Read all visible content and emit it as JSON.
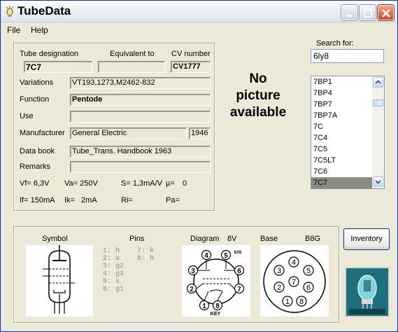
{
  "window": {
    "title": "TubeData"
  },
  "menu": {
    "file": "File",
    "help": "Help"
  },
  "tube": {
    "designation_label": "Tube designation",
    "designation": "7C7",
    "equivalent_label": "Equivalent to",
    "equivalent": "",
    "cv_label": "CV number",
    "cv": "CV1777",
    "variations_label": "Variations",
    "variations": "VT193,1273,M2462-832",
    "function_label": "Function",
    "function": "Pentode",
    "use_label": "Use",
    "use": "",
    "manufacturer_label": "Manufacturer",
    "manufacturer": "General Electric",
    "year": "1946",
    "databook_label": "Data book",
    "databook": "Tube_Trans. Handbook 1963",
    "remarks_label": "Remarks",
    "remarks": "",
    "vf": "Vf= 6,3V",
    "va": "Va= 250V",
    "s": "S= 1,3mA/V",
    "mu": "µ=",
    "mu_val": "0",
    "if": "If= 150mA",
    "ik": "Ik=",
    "ik_val": "2mA",
    "ri": "Ri=",
    "pa": "Pa="
  },
  "picture": {
    "line1": "No",
    "line2": "picture",
    "line3": "available"
  },
  "search": {
    "label": "Search for:",
    "value": "6ly8"
  },
  "list": {
    "items": [
      "7BP1",
      "7BP4",
      "7BP7",
      "7BP7A",
      "7C",
      "7C4",
      "7C5",
      "7C5LT",
      "7C6",
      "7C7"
    ],
    "selected": "7C7"
  },
  "bottom": {
    "symbol_label": "Symbol",
    "pins_label": "Pins",
    "diagram_label": "Diagram",
    "diagram_code": "8V",
    "base_label": "Base",
    "base_code": "B8G",
    "pins": [
      "1: h",
      "2: a",
      "3: g2",
      "4: g3",
      "5: s",
      "6: g1",
      "7: k",
      "8: h"
    ],
    "diagram_pin_labels": [
      "4",
      "5",
      "S/IS",
      "3",
      "6",
      "2",
      "7",
      "1",
      "8",
      "KEY"
    ],
    "base_pin_labels": [
      "3",
      "4",
      "5",
      "2",
      "6",
      "1",
      "8",
      "7"
    ]
  },
  "inventory_label": "Inventory",
  "colors": {
    "title_bar": "#eef0f6",
    "selection": "#8d8a80",
    "window_bg": "#ece9d8",
    "thumb_bg": "#0e5a6a"
  }
}
